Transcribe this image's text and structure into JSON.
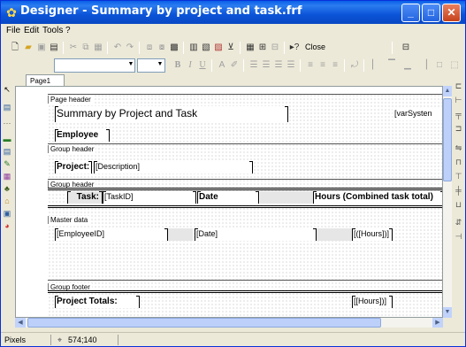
{
  "window": {
    "title": "Designer - Summary by project and task.frf",
    "controls": {
      "minimize": "_",
      "maximize": "□",
      "close": "✕"
    }
  },
  "menu": [
    {
      "label": "File",
      "key": "F"
    },
    {
      "label": "Edit",
      "key": "E"
    },
    {
      "label": "Tools",
      "key": "T"
    },
    {
      "label": "?",
      "key": ""
    }
  ],
  "toolbar": {
    "close_label": "Close",
    "icons": [
      "new-icon",
      "open-icon",
      "save-icon",
      "preview-icon",
      "cut-icon",
      "copy-icon",
      "paste-icon",
      "undo-icon",
      "redo-icon",
      "group-icon",
      "ungroup-icon",
      "bring-front-icon",
      "send-back-icon",
      "insert-band-icon",
      "grid-icon",
      "snap-icon",
      "help-icon"
    ]
  },
  "format_toolbar": {
    "font_value": "",
    "size_value": "",
    "buttons": [
      "B",
      "I",
      "U",
      "A"
    ]
  },
  "tabs": [
    {
      "label": "Page1"
    }
  ],
  "report": {
    "page_header": {
      "band_label": "Page header",
      "title_field": "Summary by Project and Task",
      "system_field": "[varSysten"
    },
    "group_header_1": {
      "band_label": "Group header",
      "employee_field": "Employee",
      "project_label": "Project:",
      "description_field": "[Description]"
    },
    "group_header_2": {
      "band_label": "Group header",
      "task_label": "Task:",
      "taskid_field": "[TaskID]",
      "date_label": "Date",
      "hours_label": "Hours (Combined task total)"
    },
    "master_data": {
      "band_label": "Master data",
      "employeeid_field": "[EmployeeID]",
      "date_field": "[Date]",
      "hours_field": "[([Hours])]"
    },
    "group_footer": {
      "band_label": "Group footer",
      "totals_label": "Project Totals:",
      "sum_field": "[[Hours])]"
    }
  },
  "statusbar": {
    "units": "Pixels",
    "position": "574;140"
  }
}
